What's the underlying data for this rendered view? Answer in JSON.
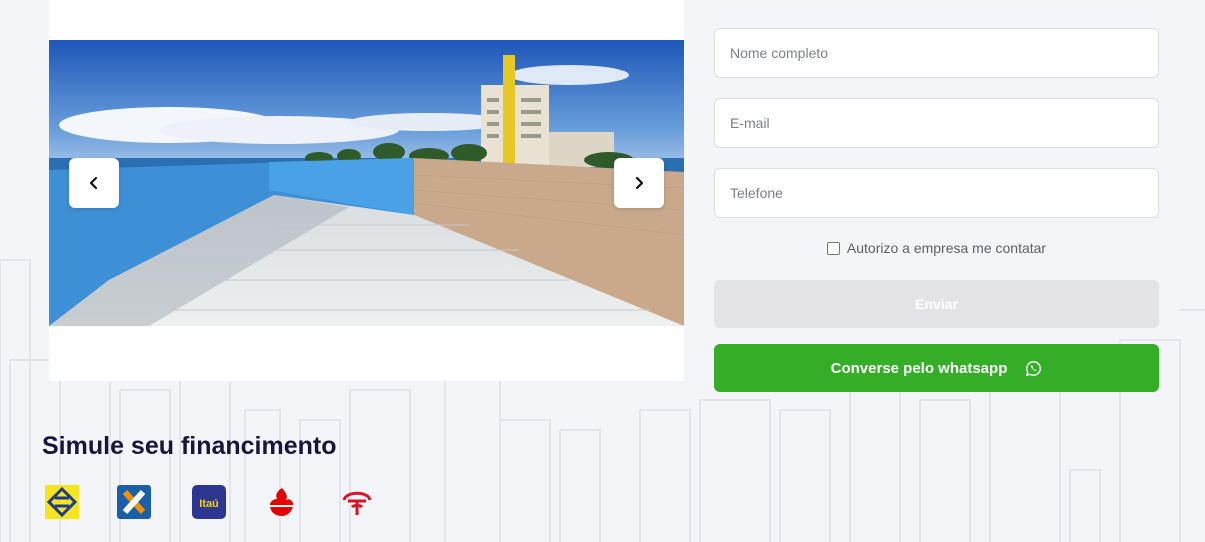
{
  "gallery": {
    "prev_icon": "chevron-left-icon",
    "next_icon": "chevron-right-icon",
    "photo_description_icon": "property-photo"
  },
  "form": {
    "name_placeholder": "Nome completo",
    "email_placeholder": "E-mail",
    "phone_placeholder": "Telefone",
    "consent_label": "Autorizo a empresa me contatar",
    "consent_checked": false,
    "submit_label": "Enviar",
    "whatsapp_label": "Converse pelo whatsapp",
    "whatsapp_icon": "whatsapp-icon"
  },
  "financing": {
    "title": "Simule seu financimento",
    "banks": [
      {
        "name": "banco-do-brasil",
        "color": "#f8e51f"
      },
      {
        "name": "caixa",
        "color": "#1b5fa9"
      },
      {
        "name": "itau",
        "label": "Itaú",
        "color": "#2d3690"
      },
      {
        "name": "santander",
        "color": "#e60000"
      },
      {
        "name": "bradesco",
        "color": "#d9142a"
      }
    ]
  },
  "colors": {
    "accent_green": "#34ad27",
    "disabled_button": "#e4e4e8",
    "title": "#15163a",
    "background": "#f4f5f9"
  }
}
